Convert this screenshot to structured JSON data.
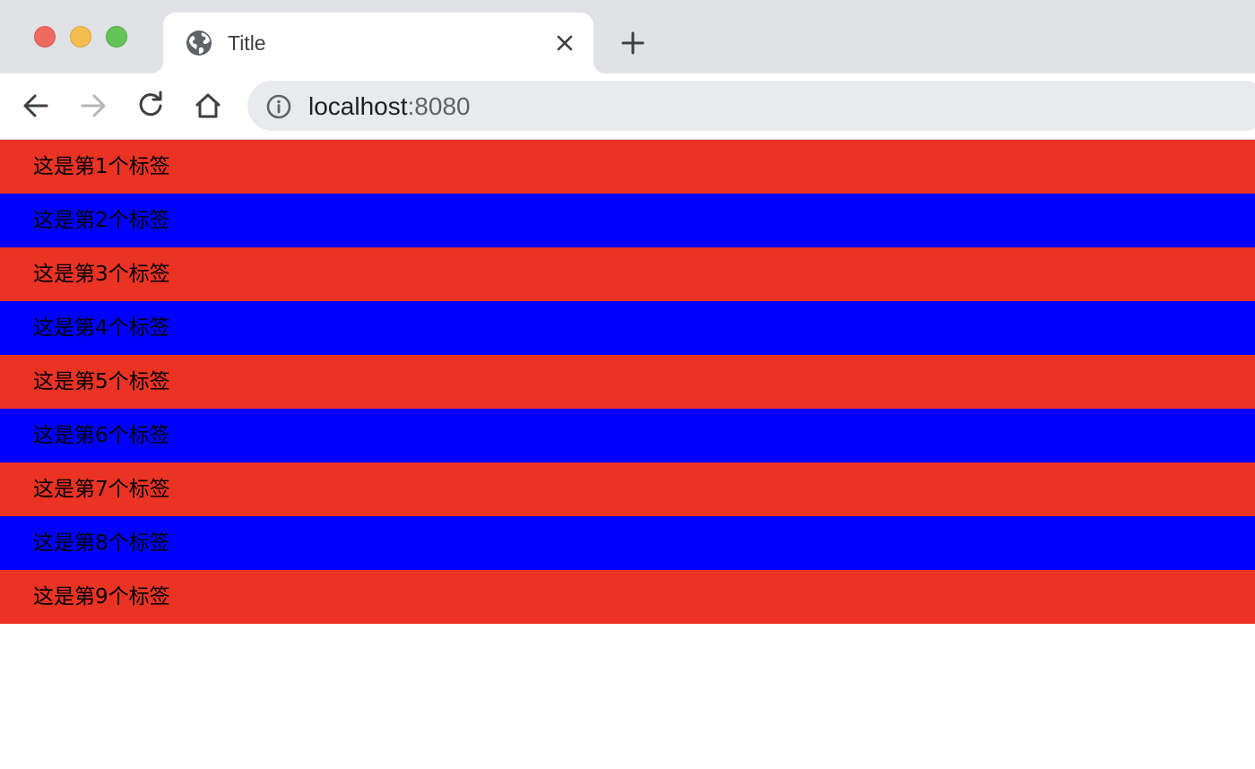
{
  "browser": {
    "tab": {
      "title": "Title",
      "favicon_icon": "globe-icon",
      "close_icon": "close-icon"
    },
    "new_tab_icon": "plus-icon",
    "nav": {
      "back_icon": "arrow-left-icon",
      "forward_icon": "arrow-right-icon",
      "reload_icon": "reload-icon",
      "home_icon": "home-icon"
    },
    "address": {
      "info_icon": "info-icon",
      "host": "localhost",
      "port": ":8080"
    },
    "traffic_colors": {
      "close": "#ee6a5f",
      "minimize": "#f5bd4f",
      "maximize": "#61c454"
    }
  },
  "page": {
    "colors": {
      "odd": "#eb3324",
      "even": "#0000ff"
    },
    "rows": [
      {
        "label": "这是第1个标签"
      },
      {
        "label": "这是第2个标签"
      },
      {
        "label": "这是第3个标签"
      },
      {
        "label": "这是第4个标签"
      },
      {
        "label": "这是第5个标签"
      },
      {
        "label": "这是第6个标签"
      },
      {
        "label": "这是第7个标签"
      },
      {
        "label": "这是第8个标签"
      },
      {
        "label": "这是第9个标签"
      }
    ]
  }
}
